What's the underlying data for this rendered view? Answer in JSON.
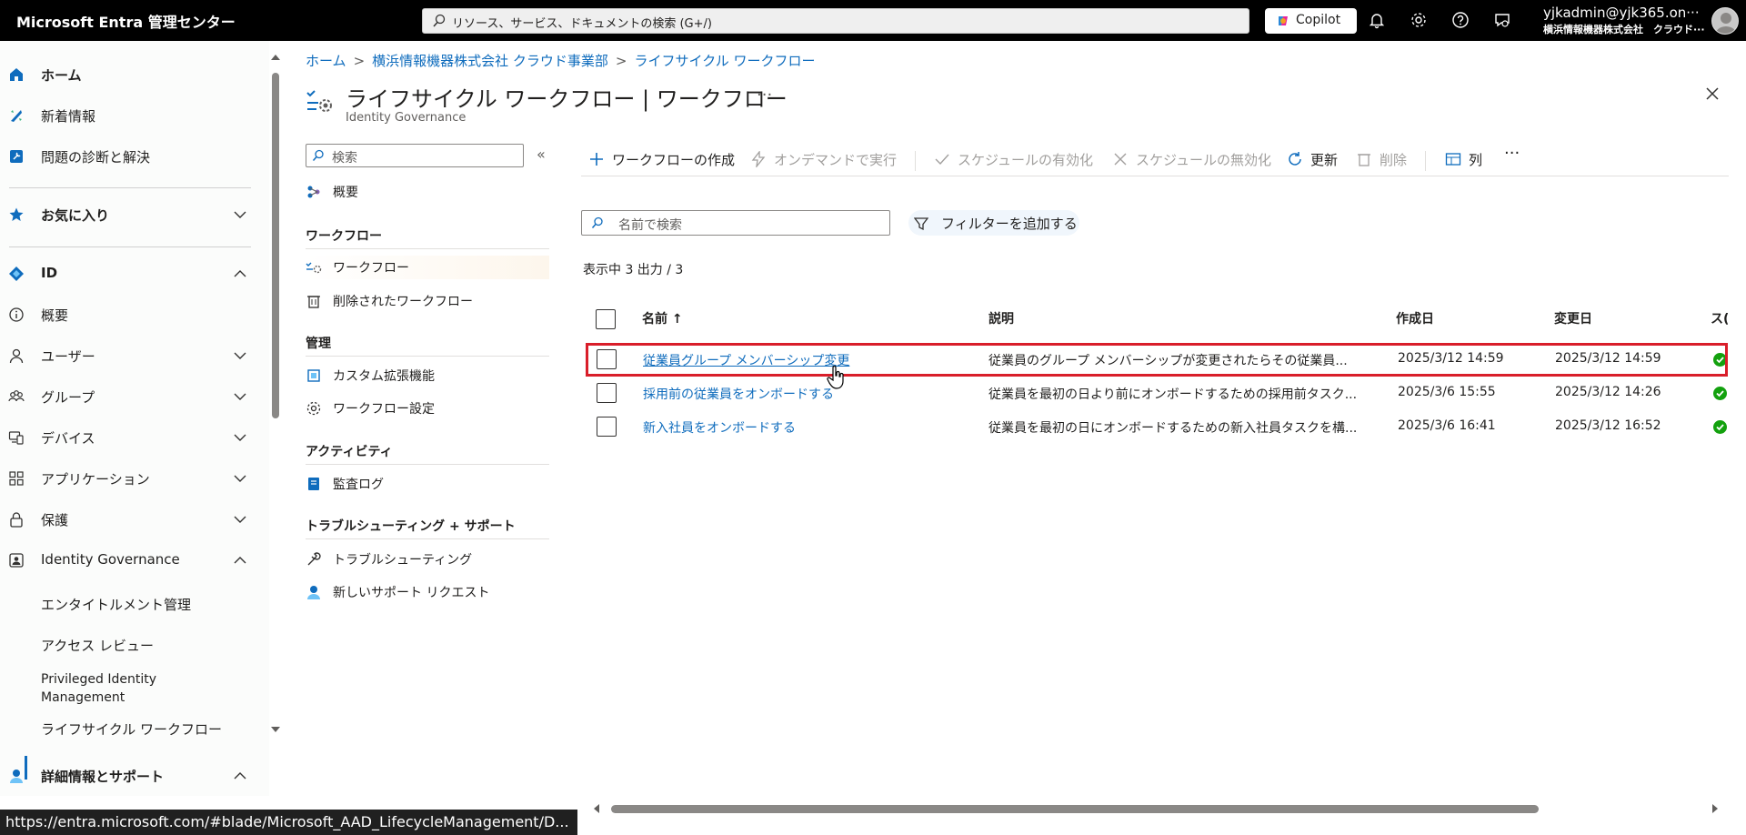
{
  "topbar": {
    "brand": "Microsoft Entra 管理センター",
    "search_placeholder": "リソース、サービス、ドキュメントの検索 (G+/)",
    "copilot_label": "Copilot",
    "account_name": "yjkadmin@yjk365.on···",
    "account_org": "横浜情報機器株式会社　クラウド···"
  },
  "leftnav": {
    "home": "ホーム",
    "whats_new": "新着情報",
    "diagnose": "問題の診断と解決",
    "favorites": "お気に入り",
    "id": "ID",
    "overview": "概要",
    "users": "ユーザー",
    "groups": "グループ",
    "devices": "デバイス",
    "applications": "アプリケーション",
    "protection": "保護",
    "identity_governance": "Identity Governance",
    "entitlement": "エンタイトルメント管理",
    "access_review": "アクセス レビュー",
    "pim_line1": "Privileged Identity",
    "pim_line2": "Management",
    "lifecycle": "ライフサイクル ワークフロー",
    "learn_support": "詳細情報とサポート"
  },
  "breadcrumb": {
    "home": "ホーム",
    "org": "横浜情報機器株式会社 クラウド事業部",
    "current": "ライフサイクル ワークフロー"
  },
  "header": {
    "title": "ライフサイクル ワークフロー | ワークフロー",
    "subtitle": "Identity Governance",
    "more": "···"
  },
  "menu": {
    "search_placeholder": "検索",
    "collapse": "«",
    "overview": "概要",
    "section_workflow": "ワークフロー",
    "workflows": "ワークフロー",
    "deleted_workflows": "削除されたワークフロー",
    "section_manage": "管理",
    "custom_extensions": "カスタム拡張機能",
    "workflow_settings": "ワークフロー設定",
    "section_activity": "アクティビティ",
    "audit_logs": "監査ログ",
    "section_troubleshoot": "トラブルシューティング + サポート",
    "troubleshooting": "トラブルシューティング",
    "new_support": "新しいサポート リクエスト"
  },
  "toolbar": {
    "create": "ワークフローの作成",
    "run_on_demand": "オンデマンドで実行",
    "enable_schedule": "スケジュールの有効化",
    "disable_schedule": "スケジュールの無効化",
    "refresh": "更新",
    "delete": "削除",
    "columns": "列",
    "more": "···"
  },
  "filter": {
    "search_placeholder": "名前で検索",
    "add_filter": "フィルターを追加する",
    "count": "表示中 3 出力 / 3"
  },
  "table": {
    "headers": {
      "name": "名前 ↑",
      "description": "説明",
      "created": "作成日",
      "modified": "変更日",
      "status": "ス("
    },
    "rows": [
      {
        "name": "従業員グループ メンバーシップ変更",
        "description": "従業員のグループ メンバーシップが変更されたらその従業員...",
        "created": "2025/3/12 14:59",
        "modified": "2025/3/12 14:59",
        "status_color": "#13a10e"
      },
      {
        "name": "採用前の従業員をオンボードする",
        "description": "従業員を最初の日より前にオンボードするための採用前タスク...",
        "created": "2025/3/6 15:55",
        "modified": "2025/3/12 14:26",
        "status_color": "#13a10e"
      },
      {
        "name": "新入社員をオンボードする",
        "description": "従業員を最初の日にオンボードするための新入社員タスクを構...",
        "created": "2025/3/6 16:41",
        "modified": "2025/3/12 16:52",
        "status_color": "#13a10e"
      }
    ]
  },
  "statusbar": {
    "url": "https://entra.microsoft.com/#blade/Microsoft_AAD_LifecycleManagement/D..."
  },
  "colors": {
    "accent": "#0f6cbd",
    "highlight": "#d91e2a",
    "status_ok": "#13a10e"
  }
}
